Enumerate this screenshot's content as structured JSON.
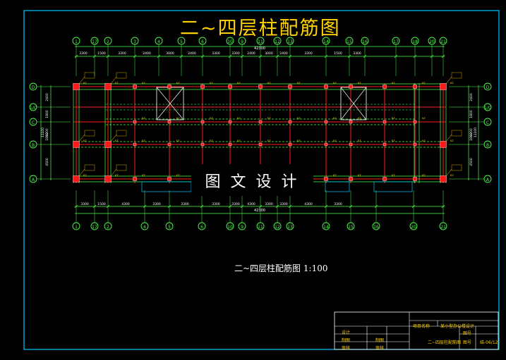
{
  "title": "二~四层柱配筋图",
  "scale_label": "二~四层柱配筋图",
  "scale_ratio": "1:100",
  "watermark": "图文设计",
  "grid_top": [
    "1",
    "17",
    "2",
    "3",
    "4",
    "5",
    "6",
    "10",
    "9",
    "11",
    "12",
    "13",
    "14",
    "15",
    "16",
    "17",
    "18",
    "20",
    "21"
  ],
  "grid_bottom": [
    "1",
    "17",
    "2",
    "4",
    "5",
    "6",
    "10",
    "9",
    "11",
    "12",
    "13",
    "14",
    "15",
    "16",
    "20",
    "21"
  ],
  "grid_rows": [
    "D",
    "1/C",
    "C",
    "B",
    "A"
  ],
  "dims_top": [
    "3300",
    "1500",
    "3300",
    "2400",
    "3000",
    "2400",
    "3300",
    "3300",
    "2400",
    "3000",
    "2400",
    "3300",
    "1500",
    "3300"
  ],
  "dims_bottom": [
    "3300",
    "1500",
    "4300",
    "3300",
    "3300",
    "3300",
    "3300",
    "4300",
    "3300",
    "3300",
    "4300",
    "3300"
  ],
  "total_dim_top": "42300",
  "total_dim_bottom": "42300",
  "dims_side": [
    "2400",
    "1800",
    "1200",
    "1800",
    "4500"
  ],
  "side_total": "11100",
  "title_block": {
    "project_label": "项目名称",
    "project_value": "某小型办公楼设计",
    "drawing_name": "二~四层柱配筋图",
    "drawn_label": "制图",
    "check_label": "审核",
    "design_label": "设计",
    "scale_label": "图号",
    "scale_value": "结-06/12",
    "no_label": "图号"
  },
  "colors": {
    "background": "#000000",
    "frame": "#00c8ff",
    "grid_axis": "#ff2020",
    "column": "#ff1a1a",
    "beam": "#4cff4c",
    "label": "#ffd200",
    "dim": "#ffffff"
  }
}
